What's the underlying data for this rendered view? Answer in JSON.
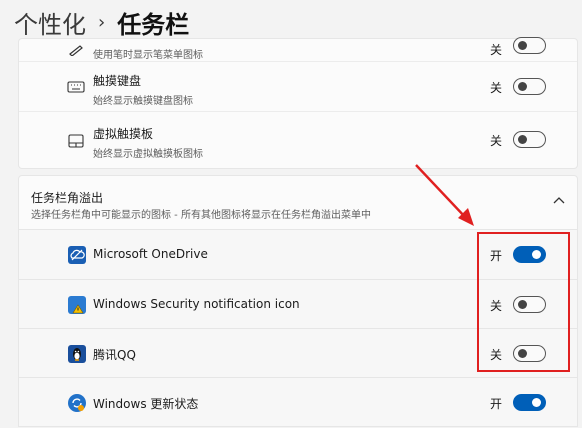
{
  "breadcrumb": {
    "parent": "个性化",
    "separator": "›",
    "current": "任务栏"
  },
  "pen_row": {
    "subtitle": "使用笔时显示笔菜单图标",
    "state": "关"
  },
  "touch_keyboard": {
    "title": "触摸键盘",
    "subtitle": "始终显示触摸键盘图标",
    "state": "关"
  },
  "virtual_touchpad": {
    "title": "虚拟触摸板",
    "subtitle": "始终显示虚拟触摸板图标",
    "state": "关"
  },
  "overflow_section": {
    "title": "任务栏角溢出",
    "subtitle": "选择任务栏角中可能显示的图标 - 所有其他图标将显示在任务栏角溢出菜单中",
    "items": [
      {
        "label": "Microsoft OneDrive",
        "state": "开",
        "on": true
      },
      {
        "label": "Windows Security notification icon",
        "state": "关",
        "on": false
      },
      {
        "label": "腾讯QQ",
        "state": "关",
        "on": false
      },
      {
        "label": "Windows 更新状态",
        "state": "开",
        "on": true
      }
    ]
  },
  "colors": {
    "accent": "#005fb8",
    "highlight": "#e02020"
  }
}
